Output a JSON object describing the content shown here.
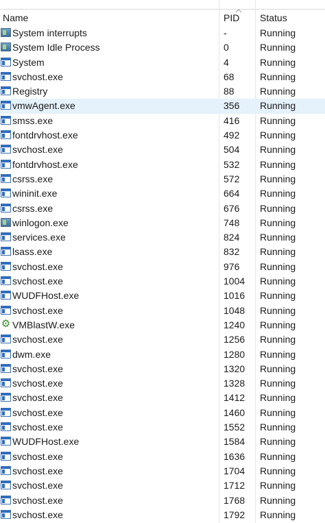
{
  "columns": {
    "name": "Name",
    "pid": "PID",
    "status": "Status"
  },
  "colors": {
    "selected_row": "#e5f1fb",
    "icon_blue": "#2f6cc0",
    "gear_green": "#3c8c2a"
  },
  "processes": [
    {
      "name": "System interrupts",
      "pid": "-",
      "status": "Running",
      "icon": "system-icon"
    },
    {
      "name": "System Idle Process",
      "pid": "0",
      "status": "Running",
      "icon": "system-icon"
    },
    {
      "name": "System",
      "pid": "4",
      "status": "Running",
      "icon": "window-icon"
    },
    {
      "name": "svchost.exe",
      "pid": "68",
      "status": "Running",
      "icon": "window-icon"
    },
    {
      "name": "Registry",
      "pid": "88",
      "status": "Running",
      "icon": "window-icon"
    },
    {
      "name": "vmwAgent.exe",
      "pid": "356",
      "status": "Running",
      "icon": "window-icon",
      "selected": true
    },
    {
      "name": "smss.exe",
      "pid": "416",
      "status": "Running",
      "icon": "window-icon"
    },
    {
      "name": "fontdrvhost.exe",
      "pid": "492",
      "status": "Running",
      "icon": "window-icon"
    },
    {
      "name": "svchost.exe",
      "pid": "504",
      "status": "Running",
      "icon": "window-icon"
    },
    {
      "name": "fontdrvhost.exe",
      "pid": "532",
      "status": "Running",
      "icon": "window-icon"
    },
    {
      "name": "csrss.exe",
      "pid": "572",
      "status": "Running",
      "icon": "window-icon"
    },
    {
      "name": "wininit.exe",
      "pid": "664",
      "status": "Running",
      "icon": "window-icon"
    },
    {
      "name": "csrss.exe",
      "pid": "676",
      "status": "Running",
      "icon": "window-icon"
    },
    {
      "name": "winlogon.exe",
      "pid": "748",
      "status": "Running",
      "icon": "system-icon"
    },
    {
      "name": "services.exe",
      "pid": "824",
      "status": "Running",
      "icon": "window-icon"
    },
    {
      "name": "lsass.exe",
      "pid": "832",
      "status": "Running",
      "icon": "window-icon"
    },
    {
      "name": "svchost.exe",
      "pid": "976",
      "status": "Running",
      "icon": "window-icon"
    },
    {
      "name": "svchost.exe",
      "pid": "1004",
      "status": "Running",
      "icon": "window-icon"
    },
    {
      "name": "WUDFHost.exe",
      "pid": "1016",
      "status": "Running",
      "icon": "window-icon"
    },
    {
      "name": "svchost.exe",
      "pid": "1048",
      "status": "Running",
      "icon": "window-icon"
    },
    {
      "name": "VMBlastW.exe",
      "pid": "1240",
      "status": "Running",
      "icon": "gear-icon"
    },
    {
      "name": "svchost.exe",
      "pid": "1256",
      "status": "Running",
      "icon": "window-icon"
    },
    {
      "name": "dwm.exe",
      "pid": "1280",
      "status": "Running",
      "icon": "window-icon"
    },
    {
      "name": "svchost.exe",
      "pid": "1320",
      "status": "Running",
      "icon": "window-icon"
    },
    {
      "name": "svchost.exe",
      "pid": "1328",
      "status": "Running",
      "icon": "window-icon"
    },
    {
      "name": "svchost.exe",
      "pid": "1412",
      "status": "Running",
      "icon": "window-icon"
    },
    {
      "name": "svchost.exe",
      "pid": "1460",
      "status": "Running",
      "icon": "window-icon"
    },
    {
      "name": "svchost.exe",
      "pid": "1552",
      "status": "Running",
      "icon": "window-icon"
    },
    {
      "name": "WUDFHost.exe",
      "pid": "1584",
      "status": "Running",
      "icon": "window-icon"
    },
    {
      "name": "svchost.exe",
      "pid": "1636",
      "status": "Running",
      "icon": "window-icon"
    },
    {
      "name": "svchost.exe",
      "pid": "1704",
      "status": "Running",
      "icon": "window-icon"
    },
    {
      "name": "svchost.exe",
      "pid": "1712",
      "status": "Running",
      "icon": "window-icon"
    },
    {
      "name": "svchost.exe",
      "pid": "1768",
      "status": "Running",
      "icon": "window-icon"
    },
    {
      "name": "svchost.exe",
      "pid": "1792",
      "status": "Running",
      "icon": "window-icon"
    }
  ]
}
